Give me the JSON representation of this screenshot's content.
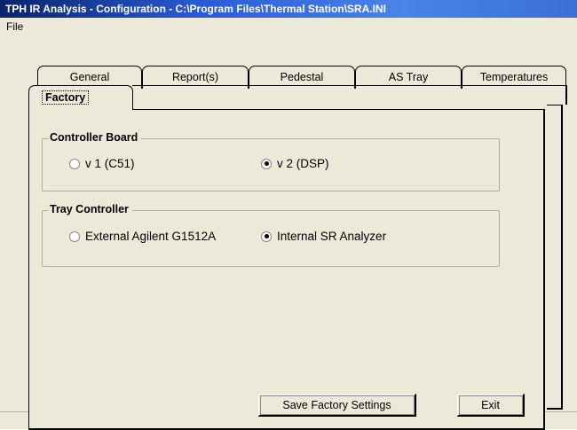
{
  "window": {
    "title": "TPH IR Analysis - Configuration - C:\\Program Files\\Thermal Station\\SRA.INI"
  },
  "menu": {
    "items": [
      {
        "label": "File"
      }
    ]
  },
  "tabs": {
    "row1": [
      {
        "label": "General"
      },
      {
        "label": "Report(s)"
      },
      {
        "label": "Pedestal"
      },
      {
        "label": "AS Tray"
      },
      {
        "label": "Temperatures"
      }
    ],
    "active": {
      "label": "Factory"
    }
  },
  "controller_board": {
    "title": "Controller Board",
    "options": [
      {
        "label": "v 1 (C51)",
        "selected": false
      },
      {
        "label": "v 2 (DSP)",
        "selected": true
      }
    ]
  },
  "tray_controller": {
    "title": "Tray Controller",
    "options": [
      {
        "label": "External Agilent G1512A",
        "selected": false
      },
      {
        "label": "Internal SR Analyzer",
        "selected": true
      }
    ]
  },
  "buttons": {
    "save_label": "Save Factory Settings",
    "exit_label": "Exit"
  }
}
